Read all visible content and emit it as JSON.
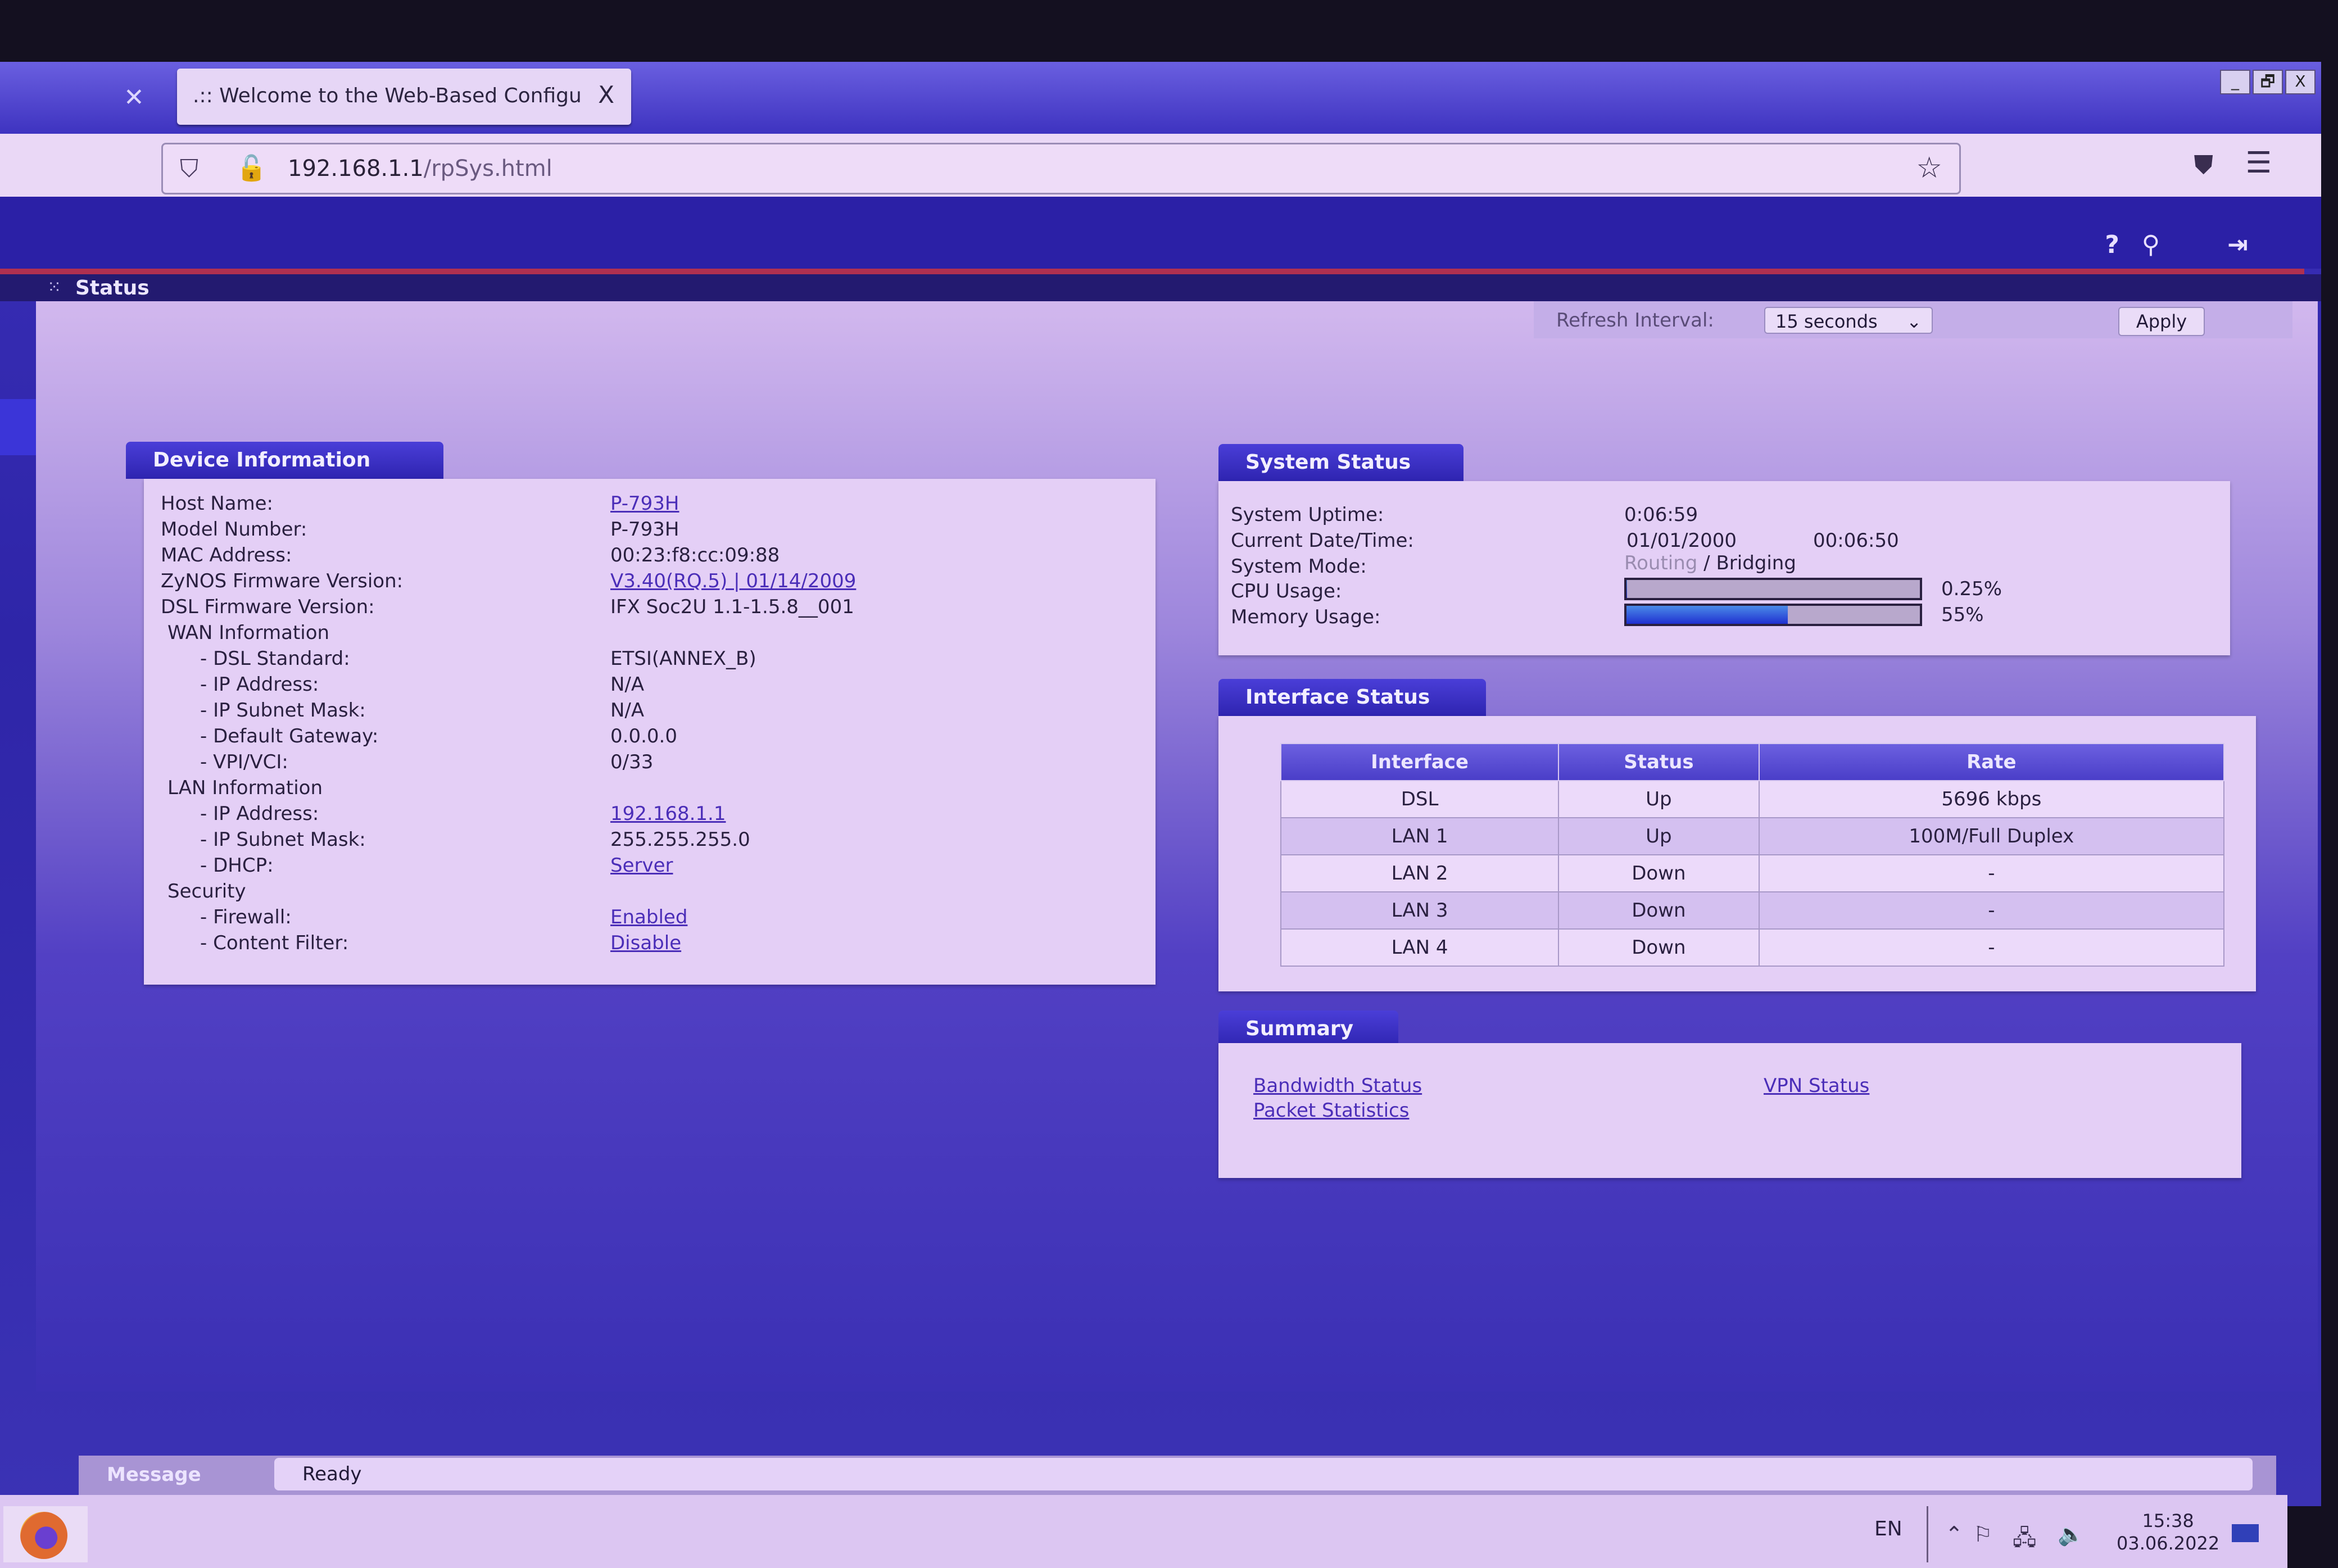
{
  "browser": {
    "tab_title": ".:: Welcome to the Web-Based Configu",
    "url_host": "192.168.1.1",
    "url_path": "/rpSys.html",
    "window_controls": [
      "_",
      "🗗",
      "X"
    ],
    "icons": {
      "shield": "⛉",
      "lock": "🔓",
      "star": "☆",
      "pocket": "⛊",
      "menu": "☰",
      "close": "✕"
    }
  },
  "router": {
    "header_icons": [
      "?",
      "⚲",
      "⇥"
    ],
    "breadcrumb": "Status",
    "refresh": {
      "label": "Refresh Interval:",
      "selected": "15 seconds",
      "apply": "Apply"
    }
  },
  "device_info": {
    "title": "Device Information",
    "rows": [
      {
        "label": "Host Name:",
        "value": "P-793H",
        "link": true
      },
      {
        "label": "Model Number:",
        "value": "P-793H",
        "link": false
      },
      {
        "label": "MAC Address:",
        "value": "00:23:f8:cc:09:88",
        "link": false
      },
      {
        "label": "ZyNOS Firmware Version:",
        "value": "V3.40(RQ.5) | 01/14/2009",
        "link": true
      },
      {
        "label": "DSL Firmware Version:",
        "value": "IFX Soc2U 1.1-1.5.8__001",
        "link": false
      },
      {
        "label": "WAN Information",
        "value": "",
        "link": false
      },
      {
        "label": "- DSL Standard:",
        "value": "ETSI(ANNEX_B)",
        "link": false
      },
      {
        "label": "- IP Address:",
        "value": "N/A",
        "link": false
      },
      {
        "label": "- IP Subnet Mask:",
        "value": "N/A",
        "link": false
      },
      {
        "label": "- Default Gateway:",
        "value": "0.0.0.0",
        "link": false
      },
      {
        "label": "- VPI/VCI:",
        "value": "0/33",
        "link": false
      },
      {
        "label": "LAN Information",
        "value": "",
        "link": false
      },
      {
        "label": "- IP Address:",
        "value": "192.168.1.1",
        "link": true
      },
      {
        "label": "- IP Subnet Mask:",
        "value": "255.255.255.0",
        "link": false
      },
      {
        "label": "- DHCP:",
        "value": "Server",
        "link": true
      },
      {
        "label": "Security",
        "value": "",
        "link": false
      },
      {
        "label": "- Firewall:",
        "value": "Enabled",
        "link": true
      },
      {
        "label": "- Content Filter:",
        "value": "Disable",
        "link": true
      }
    ]
  },
  "system_status": {
    "title": "System Status",
    "uptime_label": "System Uptime:",
    "uptime": "0:06:59",
    "datetime_label": "Current Date/Time:",
    "date": "01/01/2000",
    "time": "00:06:50",
    "mode_label": "System Mode:",
    "mode_inactive": "Routing",
    "mode_sep": " / ",
    "mode_active": "Bridging",
    "cpu_label": "CPU Usage:",
    "cpu_text": "0.25%",
    "cpu_percent": 0.25,
    "mem_label": "Memory Usage:",
    "mem_text": "55%",
    "mem_percent": 55,
    "bar_color": "#2030d0"
  },
  "interface_status": {
    "title": "Interface Status",
    "columns": [
      "Interface",
      "Status",
      "Rate"
    ],
    "rows": [
      [
        "DSL",
        "Up",
        "5696 kbps"
      ],
      [
        "LAN 1",
        "Up",
        "100M/Full Duplex"
      ],
      [
        "LAN 2",
        "Down",
        "-"
      ],
      [
        "LAN 3",
        "Down",
        "-"
      ],
      [
        "LAN 4",
        "Down",
        "-"
      ]
    ]
  },
  "summary": {
    "title": "Summary",
    "links": [
      "Bandwidth Status",
      "Packet Statistics",
      "VPN Status"
    ]
  },
  "message_bar": {
    "label": "Message",
    "value": "Ready"
  },
  "taskbar": {
    "lang": "EN",
    "time": "15:38",
    "date": "03.06.2022",
    "tray_icons": [
      "⌃",
      "⚐",
      "🖧",
      "🔈"
    ]
  },
  "colors": {
    "accent": "#2e24b0",
    "alert_line": "#b03050",
    "link": "#4b2eb8"
  }
}
